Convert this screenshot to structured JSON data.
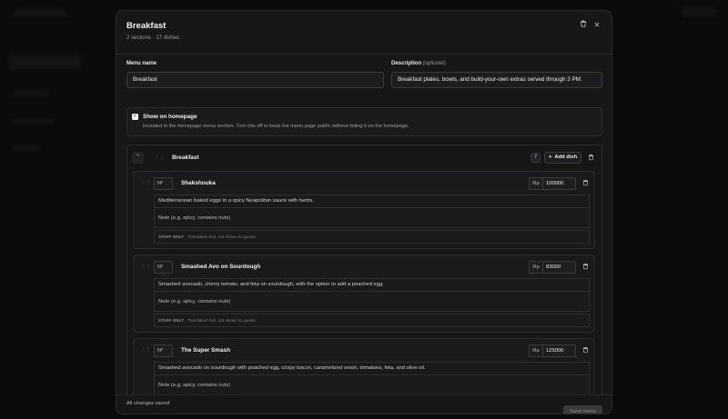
{
  "modal": {
    "title": "Breakfast",
    "subtitle": "2 sections · 17 dishes",
    "trash_icon": "trash-icon",
    "close_icon": "close-icon"
  },
  "form": {
    "menu_name_label": "Menu name",
    "menu_name_value": "Breakfast",
    "description_label": "Description",
    "description_optional": "(optional)",
    "description_value": "Breakfast plates, bowls, and build-your-own extras served through 3 PM.",
    "show_homepage": {
      "checked": true,
      "title": "Show on homepage",
      "description": "Included in the homepage menu section. Turn this off to keep the menu page public without listing it on the homepage."
    }
  },
  "section": {
    "title": "Breakfast",
    "badge": "7",
    "add_dish_label": "Add dish",
    "dishes": [
      {
        "number_placeholder": "Nº",
        "name": "Shakshouka",
        "currency": "Rp",
        "price": "100000",
        "description": "Mediterranean baked eggs in a spicy Neapolitan sauce with herbs.",
        "note_placeholder": "Note (e.g. spicy, contains nuts)",
        "staff_label": "STAFF ONLY",
        "hint_placeholder": "Translation hint, not shown to guests"
      },
      {
        "number_placeholder": "Nº",
        "name": "Smashed Avo on Sourdough",
        "currency": "Rp",
        "price": "83000",
        "description": "Smashed avocado, cherry tomato, and feta on sourdough, with the option to add a poached egg.",
        "note_placeholder": "Note (e.g. spicy, contains nuts)",
        "staff_label": "STAFF ONLY",
        "hint_placeholder": "Translation hint, not shown to guests"
      },
      {
        "number_placeholder": "Nº",
        "name": "The Super Smash",
        "currency": "Rp",
        "price": "125000",
        "description": "Smashed avocado on sourdough with poached egg, crispy bacon, caramelized onion, tomatoes, feta, and olive oil.",
        "note_placeholder": "Note (e.g. spicy, contains nuts)"
      }
    ]
  },
  "footer": {
    "status": "All changes saved",
    "save_label": "Save menu"
  }
}
